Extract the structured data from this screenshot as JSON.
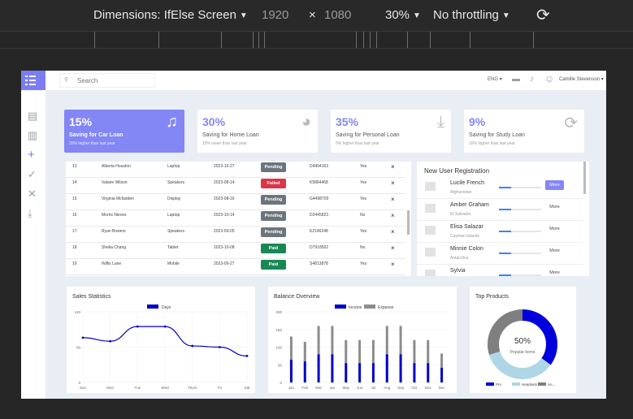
{
  "devtools": {
    "dimensions_label": "Dimensions: IfElse Screen",
    "width": "1920",
    "times": "×",
    "height": "1080",
    "zoom": "30%",
    "throttling": "No throttling",
    "caret": "▼",
    "rotate_icon": "⟳"
  },
  "topbar": {
    "search_placeholder": "Search",
    "search_icon": "⚲",
    "lang": "ENG",
    "lang_caret": "▾",
    "chat_icon": "▬",
    "bell_icon": "♪",
    "avatar_icon": "☺",
    "username": "Camille Stevenson",
    "user_caret": "▾"
  },
  "sidebar": {
    "icons": [
      "▤",
      "▥",
      "+",
      "✓",
      "✕",
      "⤓"
    ]
  },
  "cards": [
    {
      "pct": "15%",
      "title": "Saving for Car Loan",
      "sub": "30% higher than last year",
      "icon": "♫",
      "active": true
    },
    {
      "pct": "30%",
      "title": "Saving for Home Loan",
      "sub": "15% lower than last year",
      "icon": "◕",
      "active": false
    },
    {
      "pct": "35%",
      "title": "Saving for Personal Loan",
      "sub": "5% higher than last year",
      "icon": "⤓",
      "active": false
    },
    {
      "pct": "9%",
      "title": "Saving for Study Loan",
      "sub": "10% higher than last year",
      "icon": "⟳",
      "active": false
    }
  ],
  "table": {
    "rows": [
      {
        "id": "13",
        "name": "Alberta Houston",
        "product": "Laptop",
        "date": "2023-10-27",
        "status": "Pending",
        "code": "D4494163",
        "flag": "Yes",
        "action": "×"
      },
      {
        "id": "14",
        "name": "Valarie Wilson",
        "product": "Speakers",
        "date": "2023-08-14",
        "status": "Failed",
        "code": "K5864468",
        "flag": "Yes",
        "action": "×"
      },
      {
        "id": "15",
        "name": "Virginia Mcfadden",
        "product": "Display",
        "date": "2023-08-16",
        "status": "Pending",
        "code": "G4498709",
        "flag": "Yes",
        "action": "×"
      },
      {
        "id": "16",
        "name": "Morris Nieves",
        "product": "Laptop",
        "date": "2023-10-14",
        "status": "Pending",
        "code": "D2445823",
        "flag": "No",
        "action": "×"
      },
      {
        "id": "17",
        "name": "Ryan Bowers",
        "product": "Speakers",
        "date": "2023-09-05",
        "status": "Pending",
        "code": "K2146248",
        "flag": "Yes",
        "action": "×"
      },
      {
        "id": "18",
        "name": "Shelia Chang",
        "product": "Tablet",
        "date": "2023-10-08",
        "status": "Paid",
        "code": "D7918502",
        "flag": "No",
        "action": "×"
      },
      {
        "id": "19",
        "name": "Willis Lane",
        "product": "Mobile",
        "date": "2023-09-27",
        "status": "Paid",
        "code": "S4813878",
        "flag": "Yes",
        "action": "×"
      }
    ],
    "status_colors": {
      "Pending": "#6c757d",
      "Failed": "#dc3545",
      "Paid": "#198754"
    }
  },
  "new_users": {
    "title": "New User Registration",
    "button_label": "More",
    "users": [
      {
        "name": "Lucile French",
        "location": "Afghanistan",
        "progress": 0.28,
        "active": true
      },
      {
        "name": "Amber Graham",
        "location": "El Salvador",
        "progress": 0.28,
        "active": false
      },
      {
        "name": "Elisa Salazar",
        "location": "Cayman Islands",
        "progress": 0.28,
        "active": false
      },
      {
        "name": "Minnie Colon",
        "location": "Antarctica",
        "progress": 0.28,
        "active": false
      },
      {
        "name": "Sylvia",
        "location": "",
        "progress": 0.28,
        "active": false
      }
    ]
  },
  "panels": {
    "sales_title": "Sales Statistics",
    "balance_title": "Balance Overview",
    "products_title": "Top Products"
  },
  "chart_data": [
    {
      "type": "line",
      "title": "Sales Statistics",
      "legend": [
        "Days"
      ],
      "categories": [
        "Sun",
        "Mon",
        "Tue",
        "Wed",
        "Thurs",
        "Fri",
        "Sat"
      ],
      "ylim": [
        0,
        120
      ],
      "yticks": [
        "0",
        "60",
        "120"
      ],
      "series": [
        {
          "name": "Days",
          "values": [
            76,
            70,
            95,
            95,
            62,
            60,
            45
          ]
        }
      ],
      "color": "#0000cc"
    },
    {
      "type": "bar",
      "title": "Balance Overview",
      "legend": [
        "Income",
        "Expense"
      ],
      "categories": [
        "Jan",
        "Feb",
        "Mar",
        "Apr",
        "May",
        "Jun",
        "Jul",
        "Aug",
        "Sep",
        "Oct",
        "Nov",
        "Dec"
      ],
      "ylim": [
        0,
        200
      ],
      "yticks": [
        "0",
        "50",
        "100",
        "150",
        "200"
      ],
      "series": [
        {
          "name": "Income",
          "values": [
            65,
            60,
            80,
            80,
            55,
            55,
            55,
            80,
            80,
            55,
            55,
            42
          ],
          "color": "#0000cc"
        },
        {
          "name": "Expense",
          "values": [
            65,
            55,
            80,
            80,
            65,
            65,
            65,
            80,
            80,
            65,
            65,
            40
          ],
          "color": "#8c8c8c"
        }
      ],
      "stacked": true
    },
    {
      "type": "pie",
      "title": "Top Products",
      "center_value": "50%",
      "center_label": "Popular items",
      "series": [
        {
          "name": "Pro",
          "value": 35,
          "color": "#0000dd"
        },
        {
          "name": "Headsets",
          "value": 35,
          "color": "#aed6e5"
        },
        {
          "name": "An...",
          "value": 30,
          "color": "#7f7f7f"
        }
      ]
    }
  ]
}
